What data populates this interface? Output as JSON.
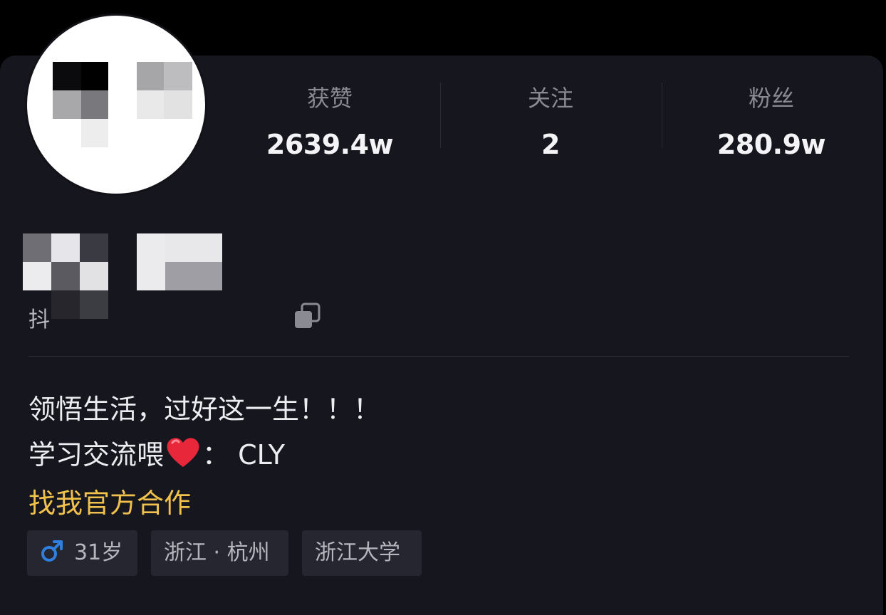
{
  "stats": [
    {
      "label": "获赞",
      "value": "2639.4w"
    },
    {
      "label": "关注",
      "value": "2"
    },
    {
      "label": "粉丝",
      "value": "280.9w"
    }
  ],
  "profile": {
    "id_prefix": "抖"
  },
  "bio": {
    "line1": "领悟生活，过好这一生！！！",
    "line2_prefix": "学习交流喂",
    "line2_suffix": "： CLY"
  },
  "cooperation_link": "找我官方合作",
  "tags": {
    "age": "31岁",
    "location": "浙江 · 杭州",
    "school": "浙江大学"
  },
  "colors": {
    "accent_gold": "#f0c24b",
    "male_blue": "#2e7fe0",
    "heart_red": "#e8283a"
  }
}
